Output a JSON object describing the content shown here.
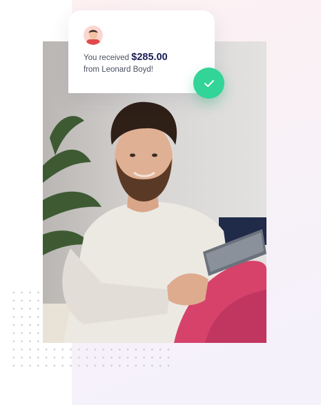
{
  "notification": {
    "prefix": "You received",
    "amount": "$285.00",
    "from_line": "from Leonard Boyd!"
  },
  "colors": {
    "accent_green": "#33d498",
    "amount_text": "#1a1e55",
    "panel_bg": "#fdf1f2"
  },
  "icons": {
    "avatar": "user-avatar",
    "check": "check-icon",
    "dots": "dot-grid-decoration"
  }
}
